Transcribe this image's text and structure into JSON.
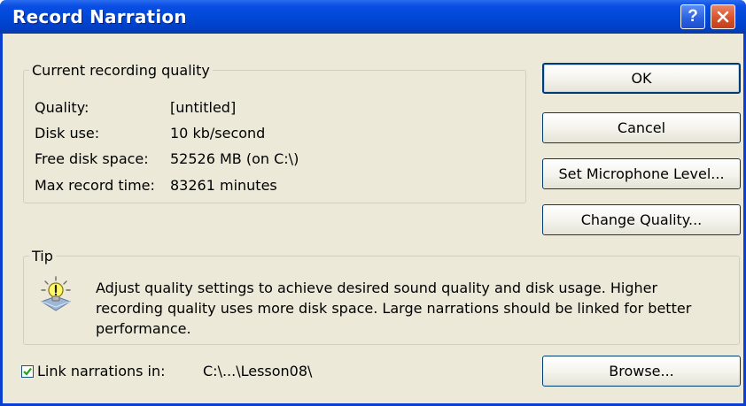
{
  "window": {
    "title": "Record Narration"
  },
  "titlebar_buttons": {
    "help_label": "?",
    "close_icon": "close-icon"
  },
  "quality_group": {
    "legend": "Current recording quality",
    "rows": [
      {
        "label": "Quality:",
        "value": "[untitled]"
      },
      {
        "label": "Disk use:",
        "value": "10 kb/second"
      },
      {
        "label": "Free disk space:",
        "value": "52526 MB (on C:\\)"
      },
      {
        "label": "Max record time:",
        "value": "83261 minutes"
      }
    ]
  },
  "buttons": {
    "ok": "OK",
    "cancel": "Cancel",
    "set_mic": "Set Microphone Level...",
    "change_quality": "Change Quality...",
    "browse": "Browse..."
  },
  "tip_group": {
    "legend": "Tip",
    "icon": "lightbulb-icon",
    "lines": [
      "Adjust quality settings to achieve desired sound quality and disk usage. Higher",
      "recording quality uses more disk space. Large narrations should be linked for better",
      "performance."
    ]
  },
  "link": {
    "checked": true,
    "label": "Link narrations in:",
    "path": "C:\\...\\Lesson08\\"
  },
  "colors": {
    "title_bar": "#0049d8",
    "dialog_bg": "#ece9d8",
    "close_button": "#d7532c",
    "button_border": "#003c74"
  }
}
